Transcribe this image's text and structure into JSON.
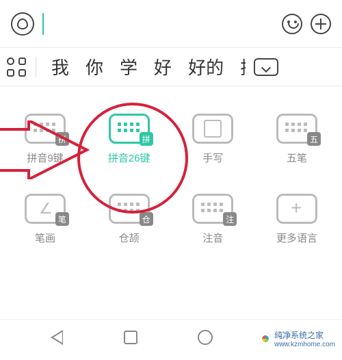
{
  "candidates": [
    "我",
    "你",
    "学",
    "好",
    "好的",
    "扩"
  ],
  "layouts": {
    "row1": [
      {
        "name": "pinyin-9key",
        "label": "拼音9键",
        "badge": "拼",
        "active": false,
        "iconClass": "kb-ic"
      },
      {
        "name": "pinyin-26key",
        "label": "拼音26键",
        "badge": "拼",
        "active": true,
        "iconClass": "kb-ic active"
      },
      {
        "name": "handwriting",
        "label": "手写",
        "badge": "",
        "active": false,
        "iconClass": "kb-ic kb-hand"
      },
      {
        "name": "wubi",
        "label": "五笔",
        "badge": "五",
        "active": false,
        "iconClass": "kb-ic"
      }
    ],
    "row2": [
      {
        "name": "bihua",
        "label": "笔画",
        "badge": "笔",
        "active": false,
        "iconClass": "kb-ic kb-stroke"
      },
      {
        "name": "cangjie",
        "label": "仓颉",
        "badge": "仓",
        "active": false,
        "iconClass": "kb-ic"
      },
      {
        "name": "zhuyin",
        "label": "注音",
        "badge": "注",
        "active": false,
        "iconClass": "kb-ic"
      },
      {
        "name": "more-languages",
        "label": "更多语言",
        "badge": "",
        "active": false,
        "iconClass": "kb-ic kb-more"
      }
    ]
  },
  "watermark": {
    "title": "纯净系统之家",
    "url": "www.kzmhome.com"
  }
}
